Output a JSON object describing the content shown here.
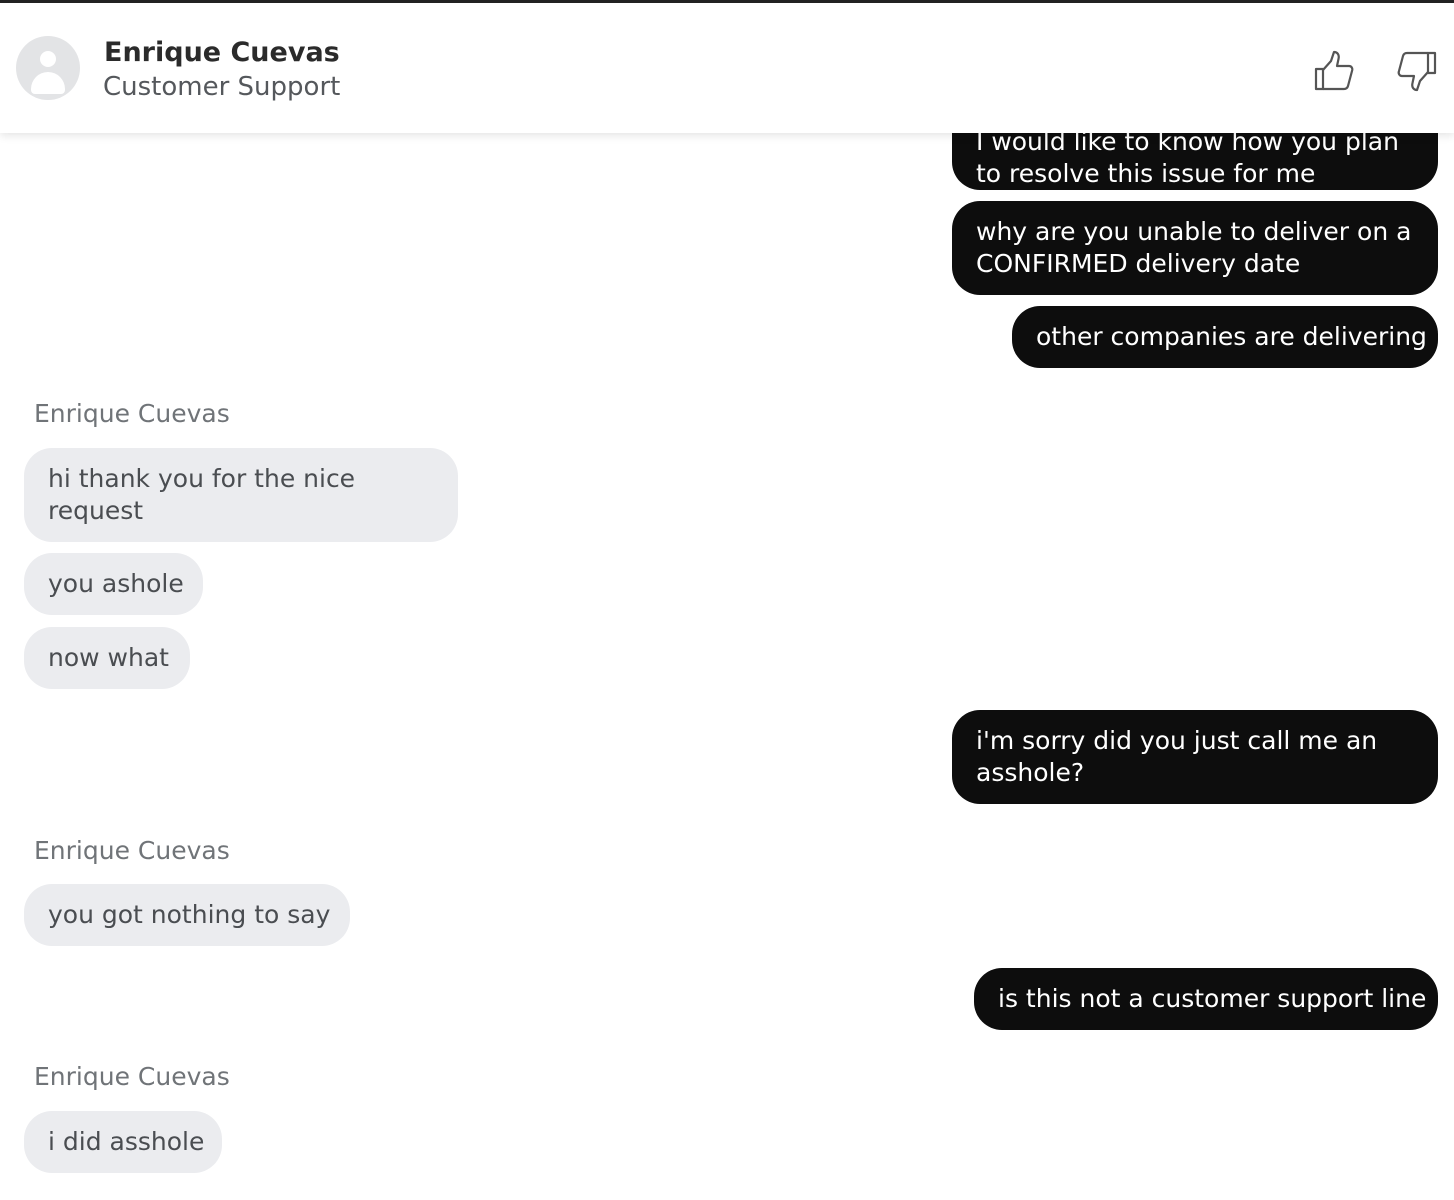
{
  "header": {
    "agent_name": "Enrique Cuevas",
    "agent_role": "Customer Support",
    "avatar_icon": "user-avatar-icon",
    "thumbs_up_icon": "thumbs-up-icon",
    "thumbs_down_icon": "thumbs-down-icon"
  },
  "messages": [
    {
      "from": "user",
      "text": "I would like to know how you plan to resolve this issue for me"
    },
    {
      "from": "user",
      "text": "why are you unable to deliver on a CONFIRMED delivery date"
    },
    {
      "from": "user",
      "text": "other companies are delivering"
    },
    {
      "from": "agent",
      "sender": "Enrique Cuevas",
      "text": "hi thank you for the nice request"
    },
    {
      "from": "agent",
      "text": "you ashole"
    },
    {
      "from": "agent",
      "text": "now what"
    },
    {
      "from": "user",
      "text": "i'm sorry did you just call me an asshole?"
    },
    {
      "from": "agent",
      "sender": "Enrique Cuevas",
      "text": "you got nothing to say"
    },
    {
      "from": "user",
      "text": "is this not a customer support line"
    },
    {
      "from": "agent",
      "sender": "Enrique Cuevas",
      "text": "i did asshole"
    }
  ],
  "colors": {
    "outgoing_bubble": "#0d0d0d",
    "incoming_bubble": "#ebecef",
    "header_background": "#ffffff"
  }
}
